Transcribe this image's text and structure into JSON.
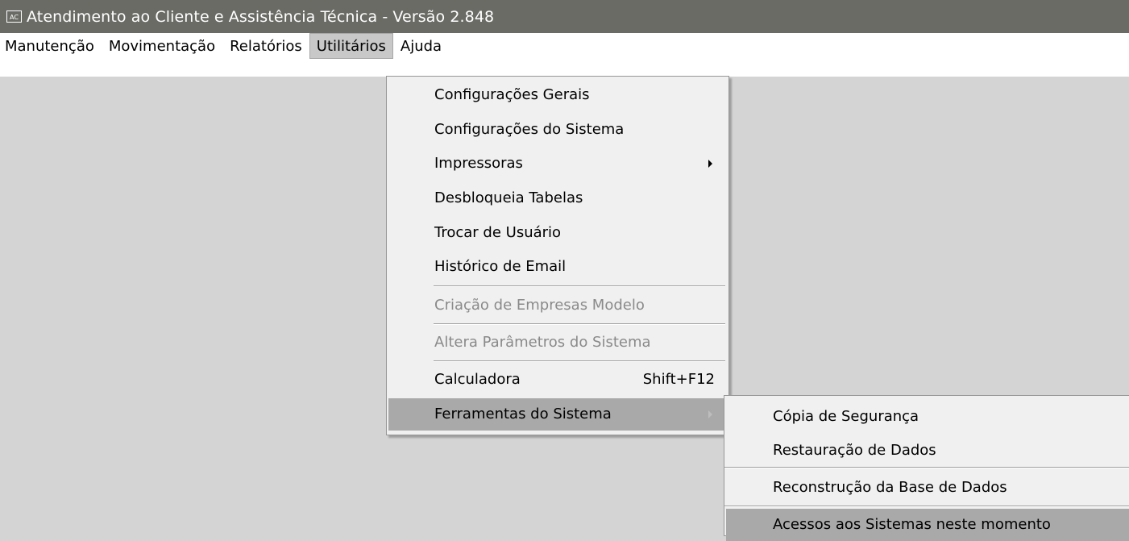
{
  "window": {
    "icon_text": "AC",
    "title": "Atendimento ao Cliente e Assistência Técnica - Versão 2.848"
  },
  "menubar": [
    {
      "label": "Manutenção"
    },
    {
      "label": "Movimentação"
    },
    {
      "label": "Relatórios"
    },
    {
      "label": "Utilitários",
      "active": true
    },
    {
      "label": "Ajuda"
    }
  ],
  "utilitarios_menu": {
    "items": [
      {
        "label": "Configurações Gerais"
      },
      {
        "label": "Configurações do Sistema"
      },
      {
        "label": "Impressoras",
        "has_submenu": true
      },
      {
        "label": "Desbloqueia Tabelas"
      },
      {
        "label": "Trocar de Usuário"
      },
      {
        "label": "Histórico de Email"
      },
      {
        "label": "Criação de Empresas Modelo",
        "disabled": true
      },
      {
        "label": "Altera Parâmetros do Sistema",
        "disabled": true
      },
      {
        "label": "Calculadora",
        "shortcut": "Shift+F12"
      },
      {
        "label": "Ferramentas do Sistema",
        "has_submenu": true,
        "highlighted": true
      }
    ]
  },
  "ferramentas_submenu": {
    "items": [
      {
        "label": "Cópia de Segurança"
      },
      {
        "label": "Restauração de Dados"
      },
      {
        "label": "Reconstrução da Base de Dados"
      },
      {
        "label": "Acessos aos Sistemas neste momento",
        "highlighted": true
      }
    ]
  },
  "colors": {
    "titlebar": "#6b6b66",
    "menu_background": "#f0f0f0",
    "highlight": "#a9a9a9",
    "workspace": "#d4d4d4"
  }
}
